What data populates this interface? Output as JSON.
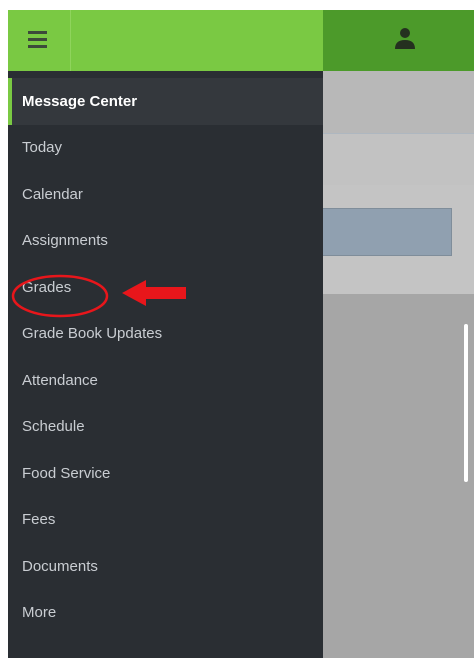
{
  "drawer": {
    "items": [
      {
        "label": "Message Center",
        "active": true
      },
      {
        "label": "Today"
      },
      {
        "label": "Calendar"
      },
      {
        "label": "Assignments"
      },
      {
        "label": "Grades"
      },
      {
        "label": "Grade Book Updates"
      },
      {
        "label": "Attendance"
      },
      {
        "label": "Schedule"
      },
      {
        "label": "Food Service"
      },
      {
        "label": "Fees"
      },
      {
        "label": "Documents"
      },
      {
        "label": "More"
      }
    ]
  },
  "icons": {
    "menu": "hamburger-menu-icon",
    "profile": "user-icon"
  },
  "colors": {
    "brand_green": "#7ac943",
    "header_dark_green": "#4c9a2a",
    "drawer_bg": "#2a2e33",
    "annotation_red": "#e8161b"
  }
}
